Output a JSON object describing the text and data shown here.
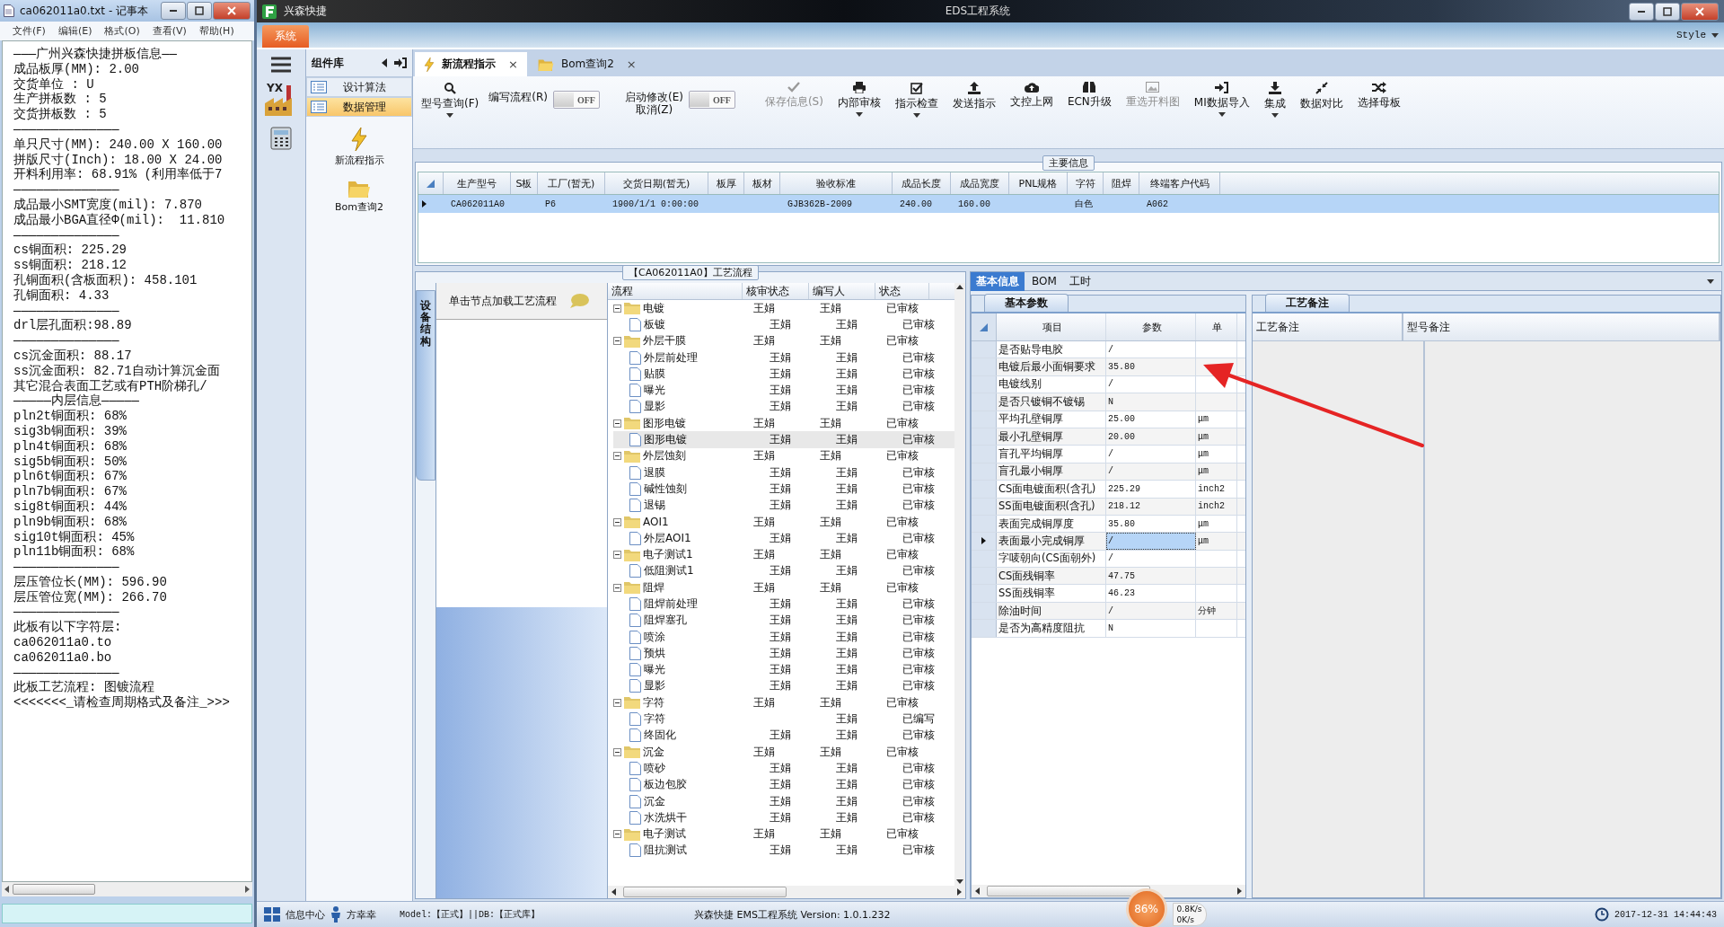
{
  "notepad": {
    "title": "ca062011a0.txt - 记事本",
    "menu": [
      "文件(F)",
      "编辑(E)",
      "格式(O)",
      "查看(V)",
      "帮助(H)"
    ],
    "lines": [
      "———广州兴森快捷拼板信息——",
      "成品板厚(MM): 2.00",
      "交货单位 : U",
      "生产拼板数 : 5",
      "交货拼板数 : 5",
      "——————————————",
      "单只尺寸(MM): 240.00 X 160.00",
      "拼版尺寸(Inch): 18.00 X 24.00",
      "开料利用率: 68.91% (利用率低于7",
      "——————————————",
      "成品最小SMT宽度(mil): 7.870",
      "成品最小BGA直径Φ(mil):  11.810",
      "——————————————",
      "cs铜面积: 225.29",
      "ss铜面积: 218.12",
      "孔铜面积(含板面积): 458.101",
      "孔铜面积: 4.33",
      "——————————————",
      "drl层孔面积:98.89",
      "——————————————",
      "cs沉金面积: 88.17",
      "ss沉金面积: 82.71自动计算沉金面",
      "其它混合表面工艺或有PTH阶梯孔/",
      "—————内层信息—————",
      "pln2t铜面积: 68%",
      "sig3b铜面积: 39%",
      "pln4t铜面积: 68%",
      "sig5b铜面积: 50%",
      "pln6t铜面积: 67%",
      "pln7b铜面积: 67%",
      "sig8t铜面积: 44%",
      "pln9b铜面积: 68%",
      "sig10t铜面积: 45%",
      "pln11b铜面积: 68%",
      "——————————————",
      "层压管位长(MM): 596.90",
      "层压管位宽(MM): 266.70",
      "——————————————",
      "此板有以下字符层:",
      "ca062011a0.to",
      "ca062011a0.bo",
      "——————————————",
      "此板工艺流程: 图镀流程",
      "<<<<<<<_请检查周期格式及备注_>>>"
    ]
  },
  "app": {
    "title": "兴森快捷",
    "center_title": "EDS工程系统",
    "ribbon_tab": "系统",
    "style_menu": "Style"
  },
  "icon_column": {
    "logo_text": "YX"
  },
  "component_panel": {
    "title": "组件库",
    "items": [
      {
        "label": "设计算法",
        "selected": false
      },
      {
        "label": "数据管理",
        "selected": true
      }
    ],
    "shortcuts": [
      {
        "label": "新流程指示"
      },
      {
        "label": "Bom查询2"
      }
    ]
  },
  "doc_tabs": [
    {
      "label": "新流程指示",
      "close": "×",
      "selected": true
    },
    {
      "label": "Bom查询2",
      "close": "×",
      "selected": false
    }
  ],
  "toolbar": [
    {
      "kind": "button",
      "label": "型号查询(F)",
      "disabled": false,
      "dropdown": true
    },
    {
      "kind": "toggle",
      "label": "编写流程(R)",
      "value": "OFF",
      "on": false
    },
    {
      "kind": "toggle",
      "label": "启动修改(E)",
      "label2": "取消(Z)",
      "value": "OFF",
      "on": false
    },
    {
      "kind": "button",
      "label": "保存信息(S)",
      "disabled": true,
      "dropdown": false
    },
    {
      "kind": "button",
      "label": "内部审核",
      "disabled": false,
      "dropdown": true
    },
    {
      "kind": "button",
      "label": "指示检查",
      "disabled": false,
      "dropdown": true
    },
    {
      "kind": "button",
      "label": "发送指示",
      "disabled": false,
      "dropdown": false
    },
    {
      "kind": "button",
      "label": "文控上网",
      "disabled": false,
      "dropdown": false
    },
    {
      "kind": "button",
      "label": "ECN升级",
      "disabled": false,
      "dropdown": false
    },
    {
      "kind": "button",
      "label": "重选开料图",
      "disabled": true,
      "dropdown": false
    },
    {
      "kind": "button",
      "label": "MI数据导入",
      "disabled": false,
      "dropdown": true
    },
    {
      "kind": "button",
      "label": "集成",
      "disabled": false,
      "dropdown": true
    },
    {
      "kind": "button",
      "label": "数据对比",
      "disabled": false,
      "dropdown": false
    },
    {
      "kind": "button",
      "label": "选择母板",
      "disabled": false,
      "dropdown": false
    }
  ],
  "main_info": {
    "title": "主要信息",
    "columns": [
      "生产型号",
      "S板",
      "工厂(暂无)",
      "交货日期(暂无)",
      "板厚",
      "板材",
      "验收标准",
      "成品长度",
      "成品宽度",
      "PNL规格",
      "字符",
      "阻焊",
      "终端客户代码"
    ],
    "rows": [
      {
        "selected": true,
        "cells": [
          "CA062011A0",
          null,
          "P6",
          "1900/1/1 0:00:00",
          null,
          null,
          "GJB362B-2009",
          "240.00",
          "160.00",
          null,
          "白色",
          null,
          "A062"
        ]
      }
    ]
  },
  "side_tab": {
    "label": "设备结构"
  },
  "load_hint": {
    "text": "单击节点加载工艺流程"
  },
  "flow_tree": {
    "title": "【CA062011A0】工艺流程",
    "columns": [
      "流程",
      "核审状态",
      "编写人",
      "状态"
    ],
    "nodes": [
      {
        "name": "电镀",
        "review": "王娟",
        "writer": "王娟",
        "status": "已审核",
        "expanded": true,
        "selected": false,
        "children": [
          {
            "name": "板镀",
            "review": "王娟",
            "writer": "王娟",
            "status": "已审核",
            "selected": false
          }
        ]
      },
      {
        "name": "外层干膜",
        "review": "王娟",
        "writer": "王娟",
        "status": "已审核",
        "expanded": true,
        "selected": false,
        "children": [
          {
            "name": "外层前处理",
            "review": "王娟",
            "writer": "王娟",
            "status": "已审核",
            "selected": false
          },
          {
            "name": "贴膜",
            "review": "王娟",
            "writer": "王娟",
            "status": "已审核",
            "selected": false
          },
          {
            "name": "曝光",
            "review": "王娟",
            "writer": "王娟",
            "status": "已审核",
            "selected": false
          },
          {
            "name": "显影",
            "review": "王娟",
            "writer": "王娟",
            "status": "已审核",
            "selected": false
          }
        ]
      },
      {
        "name": "图形电镀",
        "review": "王娟",
        "writer": "王娟",
        "status": "已审核",
        "expanded": true,
        "selected": false,
        "children": [
          {
            "name": "图形电镀",
            "review": "王娟",
            "writer": "王娟",
            "status": "已审核",
            "selected": true
          }
        ]
      },
      {
        "name": "外层蚀刻",
        "review": "王娟",
        "writer": "王娟",
        "status": "已审核",
        "expanded": true,
        "selected": false,
        "children": [
          {
            "name": "退膜",
            "review": "王娟",
            "writer": "王娟",
            "status": "已审核",
            "selected": false
          },
          {
            "name": "碱性蚀刻",
            "review": "王娟",
            "writer": "王娟",
            "status": "已审核",
            "selected": false
          },
          {
            "name": "退锡",
            "review": "王娟",
            "writer": "王娟",
            "status": "已审核",
            "selected": false
          }
        ]
      },
      {
        "name": "AOI1",
        "review": "王娟",
        "writer": "王娟",
        "status": "已审核",
        "expanded": true,
        "selected": false,
        "children": [
          {
            "name": "外层AOI1",
            "review": "王娟",
            "writer": "王娟",
            "status": "已审核",
            "selected": false
          }
        ]
      },
      {
        "name": "电子测试1",
        "review": "王娟",
        "writer": "王娟",
        "status": "已审核",
        "expanded": true,
        "selected": false,
        "children": [
          {
            "name": "低阻测试1",
            "review": "王娟",
            "writer": "王娟",
            "status": "已审核",
            "selected": false
          }
        ]
      },
      {
        "name": "阻焊",
        "review": "王娟",
        "writer": "王娟",
        "status": "已审核",
        "expanded": true,
        "selected": false,
        "children": [
          {
            "name": "阻焊前处理",
            "review": "王娟",
            "writer": "王娟",
            "status": "已审核",
            "selected": false
          },
          {
            "name": "阻焊塞孔",
            "review": "王娟",
            "writer": "王娟",
            "status": "已审核",
            "selected": false
          },
          {
            "name": "喷涂",
            "review": "王娟",
            "writer": "王娟",
            "status": "已审核",
            "selected": false
          },
          {
            "name": "预烘",
            "review": "王娟",
            "writer": "王娟",
            "status": "已审核",
            "selected": false
          },
          {
            "name": "曝光",
            "review": "王娟",
            "writer": "王娟",
            "status": "已审核",
            "selected": false
          },
          {
            "name": "显影",
            "review": "王娟",
            "writer": "王娟",
            "status": "已审核",
            "selected": false
          }
        ]
      },
      {
        "name": "字符",
        "review": "王娟",
        "writer": "王娟",
        "status": "已审核",
        "expanded": true,
        "selected": false,
        "children": [
          {
            "name": "字符",
            "writer": "王娟",
            "status": "已编写",
            "selected": false
          },
          {
            "name": "终固化",
            "review": "王娟",
            "writer": "王娟",
            "status": "已审核",
            "selected": false
          }
        ]
      },
      {
        "name": "沉金",
        "review": "王娟",
        "writer": "王娟",
        "status": "已审核",
        "expanded": true,
        "selected": false,
        "children": [
          {
            "name": "喷砂",
            "review": "王娟",
            "writer": "王娟",
            "status": "已审核",
            "selected": false
          },
          {
            "name": "板边包胶",
            "review": "王娟",
            "writer": "王娟",
            "status": "已审核",
            "selected": false
          },
          {
            "name": "沉金",
            "review": "王娟",
            "writer": "王娟",
            "status": "已审核",
            "selected": false
          },
          {
            "name": "水洗烘干",
            "review": "王娟",
            "writer": "王娟",
            "status": "已审核",
            "selected": false
          }
        ]
      },
      {
        "name": "电子测试",
        "review": "王娟",
        "writer": "王娟",
        "status": "已审核",
        "expanded": true,
        "selected": false,
        "children": [
          {
            "name": "阻抗测试",
            "review": "王娟",
            "writer": "王娟",
            "status": "已审核",
            "selected": false
          }
        ]
      }
    ]
  },
  "detail_tabs": [
    {
      "label": "基本信息",
      "selected": true
    },
    {
      "label": "BOM",
      "selected": false
    },
    {
      "label": "工时",
      "selected": false
    }
  ],
  "params": {
    "title": "基本参数",
    "columns": [
      "项目",
      "参数",
      "单"
    ],
    "rows": [
      {
        "item": "是否贴导电胶",
        "value": "/",
        "selected": false
      },
      {
        "item": "电镀后最小面铜要求",
        "value": "35.80",
        "selected": false
      },
      {
        "item": "电镀线别",
        "value": "/",
        "selected": false
      },
      {
        "item": "是否只镀铜不镀锡",
        "value": "N",
        "selected": false
      },
      {
        "item": "平均孔壁铜厚",
        "value": "25.00",
        "unit": "μm",
        "selected": false
      },
      {
        "item": "最小孔壁铜厚",
        "value": "20.00",
        "unit": "μm",
        "selected": false
      },
      {
        "item": "盲孔平均铜厚",
        "value": "/",
        "unit": "μm",
        "selected": false
      },
      {
        "item": "盲孔最小铜厚",
        "value": "/",
        "unit": "μm",
        "selected": false
      },
      {
        "item": "CS面电镀面积(含孔)",
        "value": "225.29",
        "unit": "inch2",
        "selected": false
      },
      {
        "item": "SS面电镀面积(含孔)",
        "value": "218.12",
        "unit": "inch2",
        "selected": false
      },
      {
        "item": "表面完成铜厚度",
        "value": "35.80",
        "unit": "μm",
        "selected": false
      },
      {
        "item": "表面最小完成铜厚",
        "value": "/",
        "unit": "μm",
        "selected": true
      },
      {
        "item": "字唛朝向(CS面朝外)",
        "value": "/",
        "selected": false
      },
      {
        "item": "CS面残铜率",
        "value": "47.75",
        "selected": false
      },
      {
        "item": "SS面残铜率",
        "value": "46.23",
        "selected": false
      },
      {
        "item": "除油时间",
        "value": "/",
        "unit": "分钟",
        "selected": false
      },
      {
        "item": "是否为高精度阻抗",
        "value": "N",
        "selected": false
      }
    ]
  },
  "notes": {
    "title": "工艺备注",
    "columns": [
      "工艺备注",
      "型号备注"
    ]
  },
  "status_bar": {
    "info_center": "信息中心",
    "user": "方幸幸",
    "model": "Model:【正式】||DB:【正式库】",
    "version": "兴森快捷 EMS工程系统 Version: 1.0.1.232",
    "cpu": "86%",
    "upload": "0.8K/s",
    "download": "0K/s",
    "datetime": "2017-12-31 14:44:43"
  }
}
